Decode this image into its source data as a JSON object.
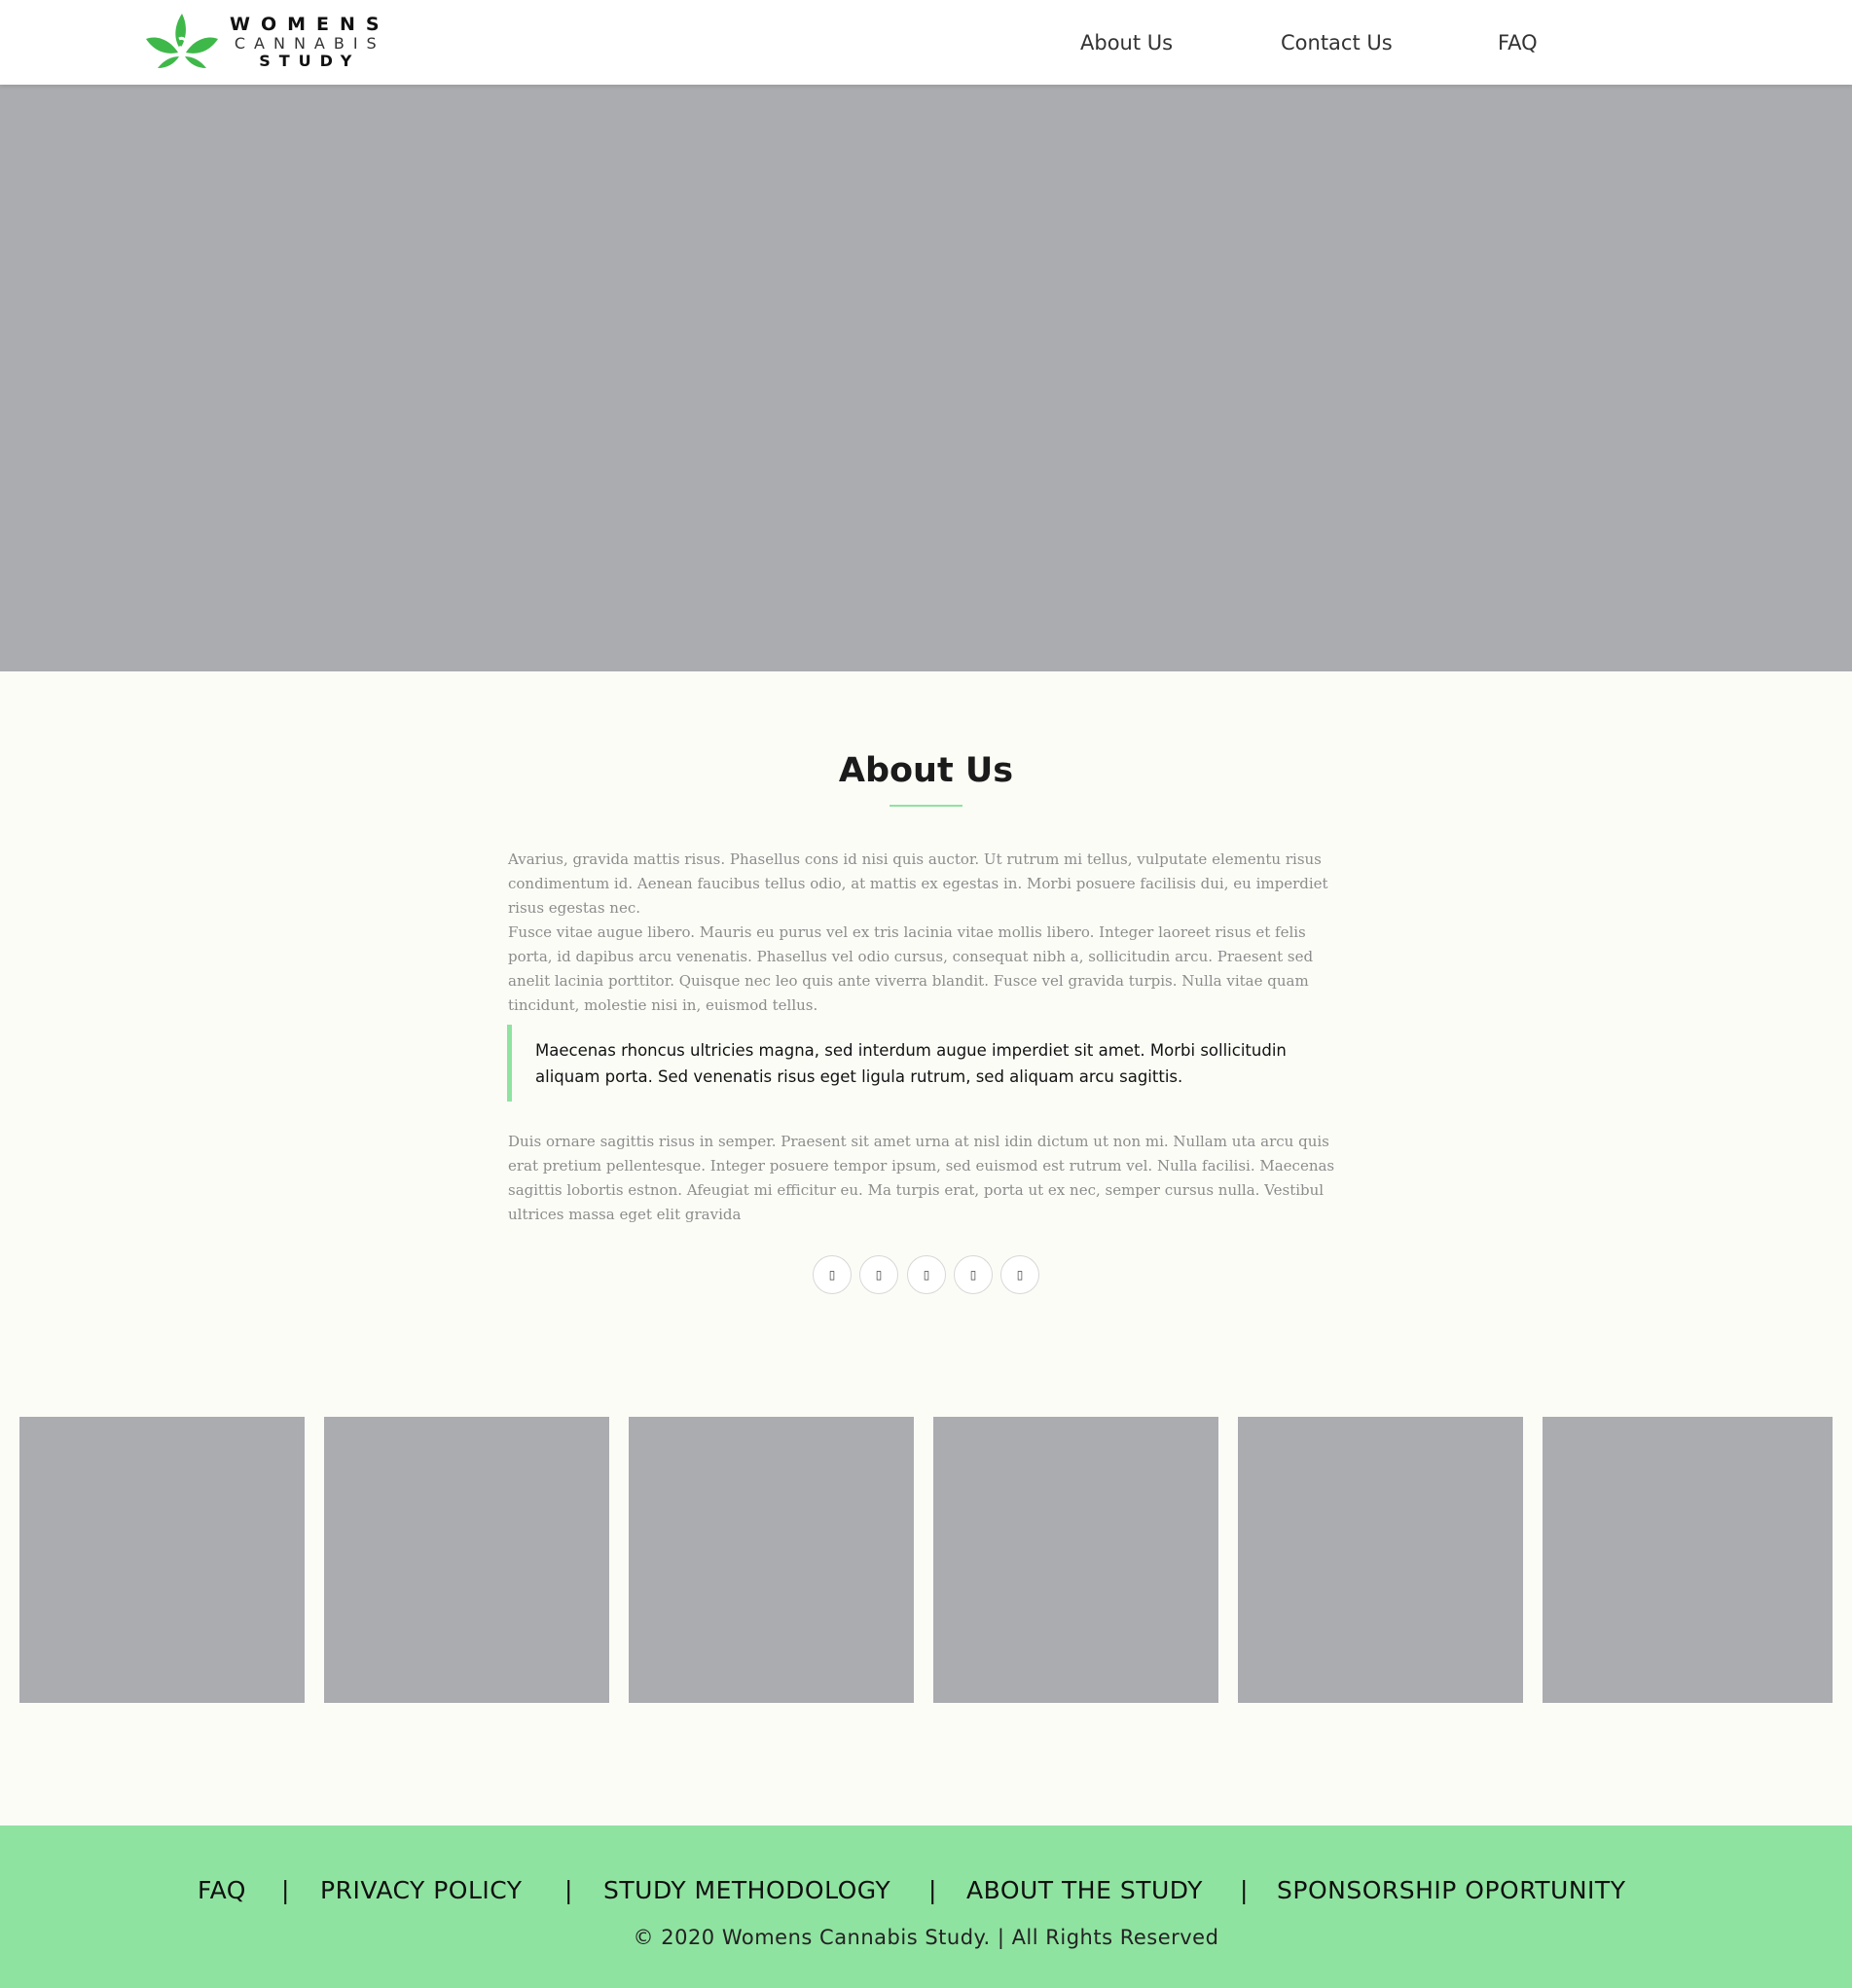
{
  "header": {
    "logo": {
      "line1": "WOMENS",
      "line2": "CANNABIS",
      "line3": "STUDY"
    },
    "nav": [
      {
        "label": "About Us"
      },
      {
        "label": "Contact Us"
      },
      {
        "label": "FAQ"
      }
    ]
  },
  "about": {
    "title": "About Us",
    "paragraphs": [
      "Avarius, gravida mattis risus. Phasellus cons id nisi quis auctor. Ut rutrum mi tellus, vulputate elementu risus condimentum id. Aenean faucibus tellus odio, at mattis ex egestas in. Morbi posuere facilisis dui, eu imperdiet risus egestas nec.",
      "Fusce vitae augue libero. Mauris eu purus vel ex tris lacinia vitae mollis libero. Integer laoreet risus et felis porta, id dapibus arcu venenatis. Phasellus vel odio cursus, consequat nibh a, sollicitudin arcu. Praesent sed anelit lacinia porttitor. Quisque nec leo quis ante viverra blandit. Fusce vel gravida turpis. Nulla vitae quam tincidunt, molestie nisi in, euismod tellus.",
      "Duis ornare sagittis risus in semper. Praesent sit amet urna at nisl idin dictum ut non mi. Nullam uta arcu quis erat pretium pellentesque. Integer posuere tempor ipsum, sed euismod est rutrum vel. Nulla facilisi. Maecenas sagittis lobortis estnon. Afeugiat mi efficitur eu. Ma turpis erat, porta ut ex nec, semper cursus nulla. Vestibul ultrices massa eget elit gravida"
    ],
    "quote": "Maecenas rhoncus ultricies magna, sed interdum augue imperdiet sit amet. Morbi sollicitudin aliquam porta. Sed venenatis risus eget ligula rutrum, sed aliquam arcu sagittis.",
    "social_icons": [
      {
        "icon": "facebook-icon",
        "glyph": "▯"
      },
      {
        "icon": "twitter-icon",
        "glyph": "▯"
      },
      {
        "icon": "instagram-icon",
        "glyph": "▯"
      },
      {
        "icon": "linkedin-icon",
        "glyph": "▯"
      },
      {
        "icon": "youtube-icon",
        "glyph": "▯"
      }
    ]
  },
  "footer": {
    "links": [
      {
        "label": "FAQ"
      },
      {
        "label": "PRIVACY POLICY"
      },
      {
        "label": "STUDY METHODOLOGY"
      },
      {
        "label": "ABOUT THE STUDY"
      },
      {
        "label": "SPONSORSHIP OPORTUNITY"
      }
    ],
    "separator": "|",
    "copyright": "© 2020 Womens Cannabis Study. | All Rights Reserved"
  },
  "colors": {
    "accent_green": "#8fe3a0",
    "logo_green": "#3fb84a",
    "placeholder_gray": "#aaacb0",
    "page_background": "#fcfcf7"
  }
}
